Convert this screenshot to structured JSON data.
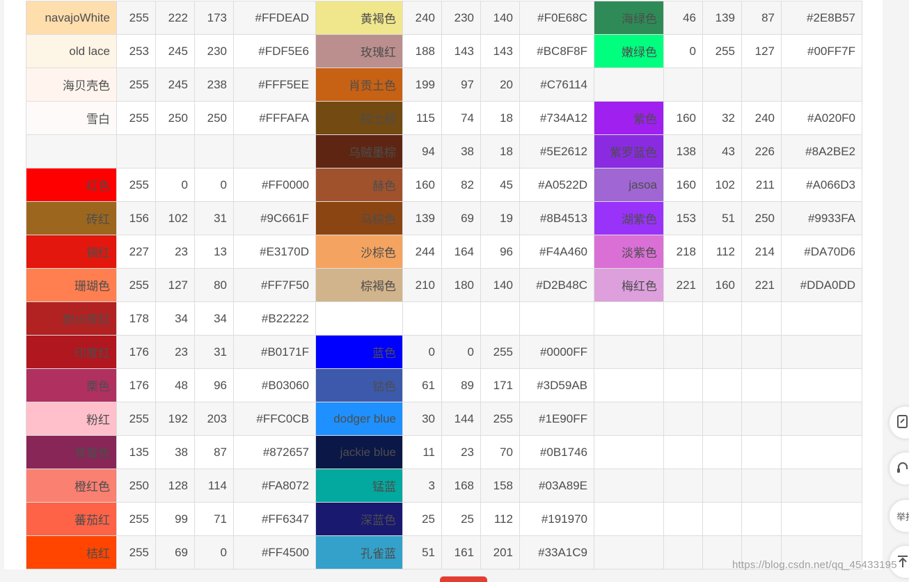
{
  "rows": [
    [
      [
        "navajoWhite",
        "255",
        "222",
        "173",
        "#FFDEAD",
        "#FFDEAD"
      ],
      [
        "黄褐色",
        "240",
        "230",
        "140",
        "#F0E68C",
        "#F0E68C"
      ],
      [
        "海绿色",
        "46",
        "139",
        "87",
        "#2E8B57",
        "#2E8B57"
      ]
    ],
    [
      [
        "old lace",
        "253",
        "245",
        "230",
        "#FDF5E6",
        "#FDF5E6"
      ],
      [
        "玫瑰红",
        "188",
        "143",
        "143",
        "#BC8F8F",
        "#BC8F8F"
      ],
      [
        "嫩绿色",
        "0",
        "255",
        "127",
        "#00FF7F",
        "#00FF7F"
      ]
    ],
    [
      [
        "海贝壳色",
        "255",
        "245",
        "238",
        "#FFF5EE",
        "#FFF5EE"
      ],
      [
        "肖贡土色",
        "199",
        "97",
        "20",
        "#C76114",
        "#C76114"
      ],
      [
        "",
        "",
        "",
        "",
        "",
        ""
      ]
    ],
    [
      [
        "雪白",
        "255",
        "250",
        "250",
        "#FFFAFA",
        "#FFFAFA"
      ],
      [
        "棕土棕",
        "115",
        "74",
        "18",
        "#734A12",
        "#734A12"
      ],
      [
        "紫色",
        "160",
        "32",
        "240",
        "#A020F0",
        "#A020F0"
      ]
    ],
    [
      [
        "",
        "",
        "",
        "",
        "",
        ""
      ],
      [
        "乌贼墨棕",
        "94",
        "38",
        "18",
        "#5E2612",
        "#5E2612"
      ],
      [
        "紫罗蓝色",
        "138",
        "43",
        "226",
        "#8A2BE2",
        "#8A2BE2"
      ]
    ],
    [
      [
        "红色",
        "255",
        "0",
        "0",
        "#FF0000",
        "#FF0000"
      ],
      [
        "赫色",
        "160",
        "82",
        "45",
        "#A0522D",
        "#A0522D"
      ],
      [
        "jasoa",
        "160",
        "102",
        "211",
        "#A066D3",
        "#A066D3"
      ]
    ],
    [
      [
        "砖红",
        "156",
        "102",
        "31",
        "#9C661F",
        "#9C661F"
      ],
      [
        "马棕色",
        "139",
        "69",
        "19",
        "#8B4513",
        "#8B4513"
      ],
      [
        "湖紫色",
        "153",
        "51",
        "250",
        "#9933FA",
        "#9933FA"
      ]
    ],
    [
      [
        "镉红",
        "227",
        "23",
        "13",
        "#E3170D",
        "#E3170D"
      ],
      [
        "沙棕色",
        "244",
        "164",
        "96",
        "#F4A460",
        "#F4A460"
      ],
      [
        "淡紫色",
        "218",
        "112",
        "214",
        "#DA70D6",
        "#DA70D6"
      ]
    ],
    [
      [
        "珊瑚色",
        "255",
        "127",
        "80",
        "#FF7F50",
        "#FF7F50"
      ],
      [
        "棕褐色",
        "210",
        "180",
        "140",
        "#D2B48C",
        "#D2B48C"
      ],
      [
        "梅红色",
        "221",
        "160",
        "221",
        "#DDA0DD",
        "#DDA0DD"
      ]
    ],
    [
      [
        "耐火砖红",
        "178",
        "34",
        "34",
        "#B22222",
        "#B22222"
      ],
      [
        "",
        "",
        "",
        "",
        "",
        ""
      ],
      [
        "",
        "",
        "",
        "",
        "",
        ""
      ]
    ],
    [
      [
        "印度红",
        "176",
        "23",
        "31",
        "#B0171F",
        "#B0171F"
      ],
      [
        "蓝色",
        "0",
        "0",
        "255",
        "#0000FF",
        "#0000FF"
      ],
      [
        "",
        "",
        "",
        "",
        "",
        ""
      ]
    ],
    [
      [
        "栗色",
        "176",
        "48",
        "96",
        "#B03060",
        "#B03060"
      ],
      [
        "钴色",
        "61",
        "89",
        "171",
        "#3D59AB",
        "#3D59AB"
      ],
      [
        "",
        "",
        "",
        "",
        "",
        ""
      ]
    ],
    [
      [
        "粉红",
        "255",
        "192",
        "203",
        "#FFC0CB",
        "#FFC0CB"
      ],
      [
        "dodger blue",
        "30",
        "144",
        "255",
        "#1E90FF",
        "#1E90FF"
      ],
      [
        "",
        "",
        "",
        "",
        "",
        ""
      ]
    ],
    [
      [
        "草莓色",
        "135",
        "38",
        "87",
        "#872657",
        "#872657"
      ],
      [
        "jackie blue",
        "11",
        "23",
        "70",
        "#0B1746",
        "#0B1746"
      ],
      [
        "",
        "",
        "",
        "",
        "",
        ""
      ]
    ],
    [
      [
        "橙红色",
        "250",
        "128",
        "114",
        "#FA8072",
        "#FA8072"
      ],
      [
        "锰蓝",
        "3",
        "168",
        "158",
        "#03A89E",
        "#03A89E"
      ],
      [
        "",
        "",
        "",
        "",
        "",
        ""
      ]
    ],
    [
      [
        "蕃茄红",
        "255",
        "99",
        "71",
        "#FF6347",
        "#FF6347"
      ],
      [
        "深蓝色",
        "25",
        "25",
        "112",
        "#191970",
        "#191970"
      ],
      [
        "",
        "",
        "",
        "",
        "",
        ""
      ]
    ],
    [
      [
        "桔红",
        "255",
        "69",
        "0",
        "#FF4500",
        "#FF4500"
      ],
      [
        "孔雀蓝",
        "51",
        "161",
        "201",
        "#33A1C9",
        "#33A1C9"
      ],
      [
        "",
        "",
        "",
        "",
        "",
        ""
      ]
    ]
  ],
  "float_toolbar": {
    "report_label": "举报"
  },
  "watermark": "https://blog.csdn.net/qq_45433195"
}
